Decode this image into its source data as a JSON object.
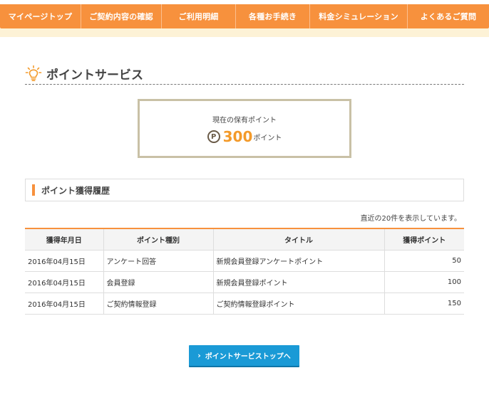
{
  "nav": {
    "items": [
      {
        "label": "マイページトップ"
      },
      {
        "label": "ご契約内容の確認"
      },
      {
        "label": "ご利用明細"
      },
      {
        "label": "各種お手続き"
      },
      {
        "label": "料金シミュレーション"
      },
      {
        "label": "よくあるご質問"
      }
    ]
  },
  "page": {
    "title": "ポイントサービス"
  },
  "points": {
    "label": "現在の保有ポイント",
    "icon_glyph": "P",
    "value": "300",
    "unit": "ポイント"
  },
  "history": {
    "title": "ポイント獲得履歴",
    "note": "直近の20件を表示しています。",
    "columns": [
      "獲得年月日",
      "ポイント種別",
      "タイトル",
      "獲得ポイント"
    ],
    "rows": [
      {
        "date": "2016年04月15日",
        "type": "アンケート回答",
        "title": "新規会員登録アンケートポイント",
        "points": "50"
      },
      {
        "date": "2016年04月15日",
        "type": "会員登録",
        "title": "新規会員登録ポイント",
        "points": "100"
      },
      {
        "date": "2016年04月15日",
        "type": "ご契約情報登録",
        "title": "ご契約情報登録ポイント",
        "points": "150"
      }
    ]
  },
  "button": {
    "chevron": "›",
    "label": "ポイントサービストップへ"
  },
  "colors": {
    "accent": "#f7913d",
    "points": "#f39a2a",
    "button": "#1a9ad6",
    "box_border": "#c9c1a6"
  },
  "icons": {
    "title": "lightbulb-icon",
    "points": "point-coin-icon",
    "button": "chevron-right-icon"
  }
}
